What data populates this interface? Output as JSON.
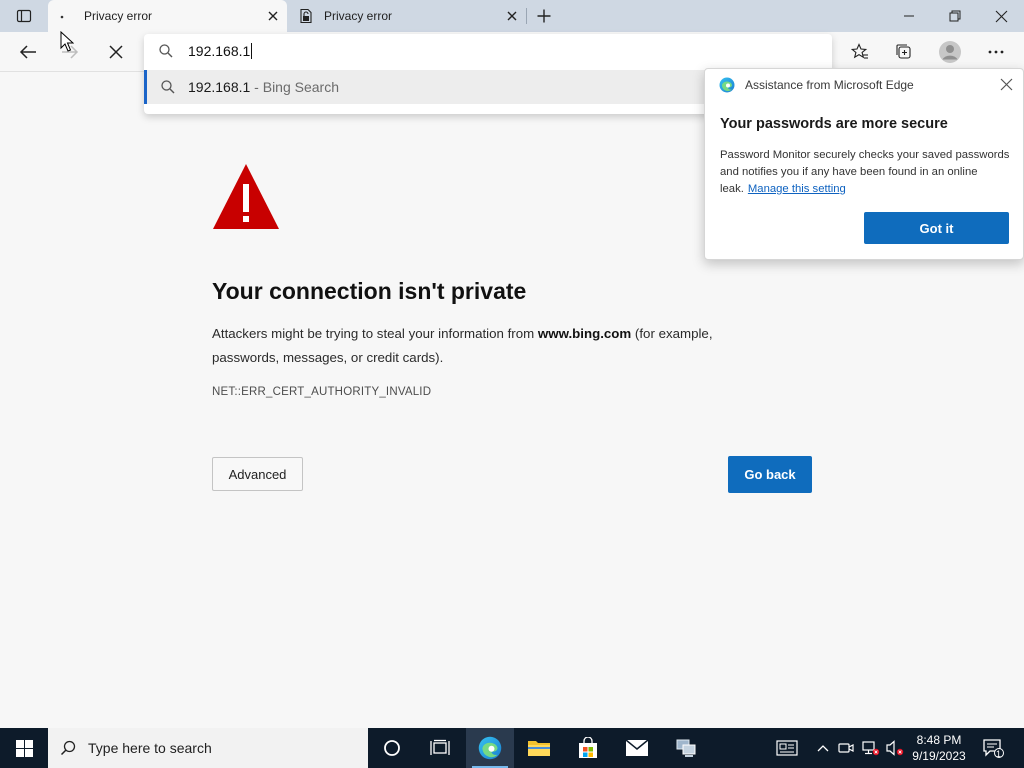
{
  "tabs": [
    {
      "title": "Privacy error",
      "active": true
    },
    {
      "title": "Privacy error",
      "active": false
    }
  ],
  "omnibox": {
    "value": "192.168.1",
    "suggestion": {
      "text": "192.168.1",
      "suffix": " - Bing Search"
    }
  },
  "popup": {
    "header": "Assistance from Microsoft Edge",
    "title": "Your passwords are more secure",
    "body": "Password Monitor securely checks your saved passwords and notifies you if any have been found in an online leak.",
    "link": "Manage this setting",
    "button": "Got it"
  },
  "page": {
    "heading": "Your connection isn't private",
    "desc_before": "Attackers might be trying to steal your information from ",
    "domain": "www.bing.com",
    "desc_after": " (for example, passwords, messages, or credit cards).",
    "error_code": "NET::ERR_CERT_AUTHORITY_INVALID",
    "advanced_button": "Advanced",
    "back_button": "Go back"
  },
  "taskbar": {
    "search_placeholder": "Type here to search",
    "time": "8:48 PM",
    "date": "9/19/2023",
    "notification_count": "1"
  },
  "colors": {
    "accent": "#0f6cbd",
    "warning": "#c80000",
    "taskbar": "#0d1b2a",
    "tabbar": "#cfd8e3"
  }
}
